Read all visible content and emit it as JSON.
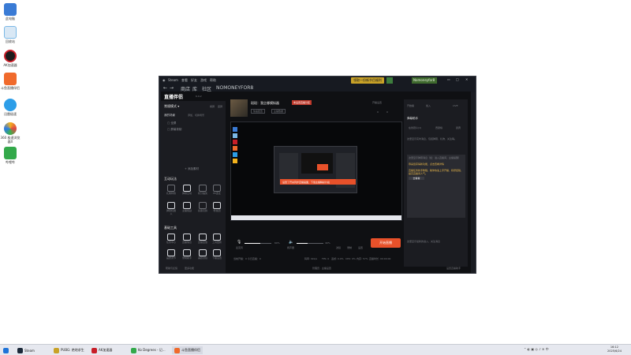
{
  "desktop_icons": [
    {
      "label": "此电脑",
      "color": "#3a7bd5"
    },
    {
      "label": "回收站",
      "color": "#7ab8e6"
    },
    {
      "label": "AK加速器",
      "color": "#c81e28"
    },
    {
      "label": "斗鱼直播伴侣",
      "color": "#f06a2c"
    },
    {
      "label": "迅雷极速",
      "color": "#2d9ee8"
    },
    {
      "label": "360 极速浏览器X",
      "color": "#f3b21d"
    },
    {
      "label": "哔哩哔",
      "color": "#33a94a"
    }
  ],
  "steam": {
    "title": "Steam",
    "menu": [
      "查看",
      "好友",
      "游戏",
      "帮助"
    ],
    "notice": "领取一份新节目福利",
    "user": "Nomoneyfor8",
    "nav": [
      "←",
      "→",
      "商店",
      "库",
      "社区",
      "NOMONEYFOR8"
    ]
  },
  "live": {
    "logo": "直播伴侣",
    "version": "6.9.2",
    "mode": "常规模式 ▾",
    "mode_actions": [
      "横屏",
      "竖屏"
    ],
    "scene_group": "我的场景",
    "scene_hint": "添加、切换场景",
    "sources": [
      "全屏",
      "屏幕录制"
    ],
    "add_source": "+ 添加素材",
    "interactive_title": "互动玩法",
    "interactive": [
      "礼物特效",
      "弹幕互动",
      "积分抽奖",
      "PK连麦",
      "弹幕机器人",
      "主播挑战",
      "投票竞猜",
      "粉丝团"
    ],
    "tools_title": "基础工具",
    "tools": [
      "任务中心",
      "直播信息",
      "直播回放",
      "工具更新",
      "画质调节",
      "录制助手",
      "美颜滤镜",
      "下播设置"
    ],
    "more_tools": "更多功能",
    "room_title": "斑斑：我企娜模拟器",
    "room_tag": "未设置直播分区",
    "room_sub": [
      "快速配置",
      "主播数据"
    ],
    "room_stats": [
      "0",
      "0"
    ],
    "room_action": "开播设置",
    "toast": "设置了开关同步直播画面，下载主播精彩片段",
    "audio": [
      {
        "name": "麦克风",
        "pct": "60%"
      },
      {
        "name": "扬声器",
        "pct": "40%"
      }
    ],
    "bottom_tools": [
      "滤镜",
      "录制",
      "设置"
    ],
    "start_button": "开始直播",
    "status_left": "当前开播：0    今日直播：0",
    "status_items": [
      "码率: 0kb/s",
      "FPS: 0",
      "丢帧: 0.0%",
      "CPU: 9%",
      "内存: 57%",
      "直播时长: 00:00:00"
    ],
    "footer": [
      "帮助与反馈",
      "管理员 · 主播设置"
    ],
    "footer_right": "设置直播助手"
  },
  "right": {
    "tabs": [
      "开始播",
      "加入",
      "LIVE"
    ],
    "live_badge": "开播",
    "sub_tabs": [
      "特殊消息",
      "我的弹幕"
    ],
    "panel_title": "弹幕助手",
    "panel_tabs": [
      "在线观众(1)",
      "贡献榜",
      "贵宾"
    ],
    "tip1": "这里显示实时消息，包括弹幕、礼物、关注等。",
    "tip2": "这里显示弹幕消息（如：进入直播间、主播提醒）",
    "tip3_highlight": "恭喜您获得新功能，点击查看详情",
    "tip4": "直播任务新手教程，助你快速上手开播，积攒经验，提高直播间人气。",
    "tip4_btn": "去看看",
    "tip_bottom": "这里显示最新的进入、关注消息"
  },
  "taskbar": {
    "items": [
      "Steam",
      "PUBG: 绝地求生",
      "AK加速器",
      "Ko Degrees - 记...",
      "斗鱼直播伴侣"
    ],
    "time": "16:12",
    "date": "2025/6/24"
  },
  "colors": {
    "accent": "#e8512a",
    "steam_bg": "#171a21",
    "panel": "#1b1c21",
    "highlight": "#e8b74a"
  }
}
